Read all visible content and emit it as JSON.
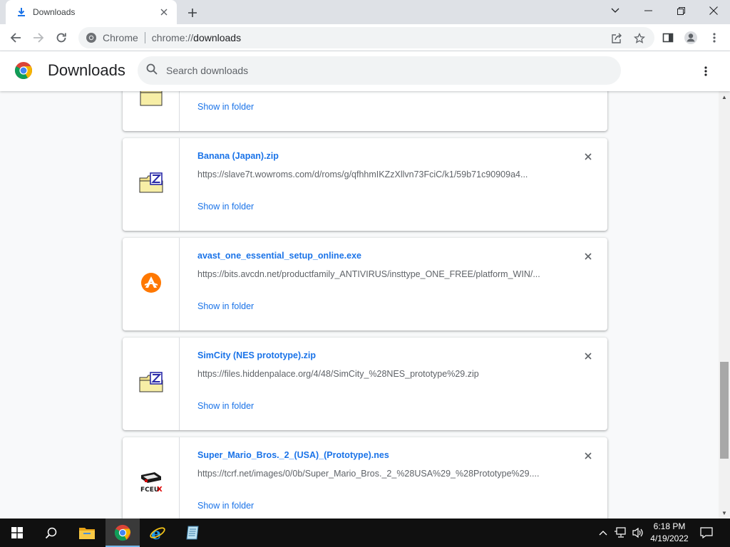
{
  "tab": {
    "title": "Downloads",
    "icon": "download-arrow-icon",
    "close_icon": "close-icon"
  },
  "new_tab_icon": "plus-icon",
  "window_controls": [
    "chevron-down-icon",
    "minimize-icon",
    "restore-icon",
    "close-icon"
  ],
  "toolbar": {
    "back_icon": "back-arrow-icon",
    "forward_icon": "forward-arrow-icon",
    "reload_icon": "reload-icon",
    "site_label": "Chrome",
    "url_scheme": "chrome://",
    "url_host": "downloads",
    "share_icon": "share-icon",
    "bookmark_icon": "star-icon",
    "side_panel_icon": "side-panel-icon",
    "profile_icon": "profile-icon",
    "menu_icon": "kebab-menu-icon"
  },
  "downloads_page": {
    "title": "Downloads",
    "search_placeholder": "Search downloads",
    "menu_icon": "kebab-menu-icon"
  },
  "downloads": [
    {
      "filename": "",
      "url": "",
      "action": "Show in folder",
      "icon": "zip-folder-icon"
    },
    {
      "filename": "Banana (Japan).zip",
      "url": "https://slave7t.wowroms.com/d/roms/g/qfhhmIKZzXllvn73FciC/k1/59b71c90909a4...",
      "action": "Show in folder",
      "icon": "zip-folder-icon"
    },
    {
      "filename": "avast_one_essential_setup_online.exe",
      "url": "https://bits.avcdn.net/productfamily_ANTIVIRUS/insttype_ONE_FREE/platform_WIN/...",
      "action": "Show in folder",
      "icon": "avast-icon"
    },
    {
      "filename": "SimCity (NES prototype).zip",
      "url": "https://files.hiddenpalace.org/4/48/SimCity_%28NES_prototype%29.zip",
      "action": "Show in folder",
      "icon": "zip-folder-icon"
    },
    {
      "filename": "Super_Mario_Bros._2_(USA)_(Prototype).nes",
      "url": "https://tcrf.net/images/0/0b/Super_Mario_Bros._2_%28USA%29_%28Prototype%29....",
      "action": "Show in folder",
      "icon": "fceux-icon"
    }
  ],
  "taskbar": {
    "apps": [
      "windows-start-icon",
      "search-icon",
      "file-explorer-icon",
      "chrome-icon",
      "internet-explorer-icon",
      "notepad-icon"
    ],
    "tray": [
      "chevron-up-icon",
      "network-icon",
      "volume-icon",
      "notification-icon"
    ],
    "time": "6:18 PM",
    "date": "4/19/2022"
  },
  "colors": {
    "link": "#1a73e8",
    "tabstrip": "#dee1e6",
    "taskbar": "#101010"
  }
}
